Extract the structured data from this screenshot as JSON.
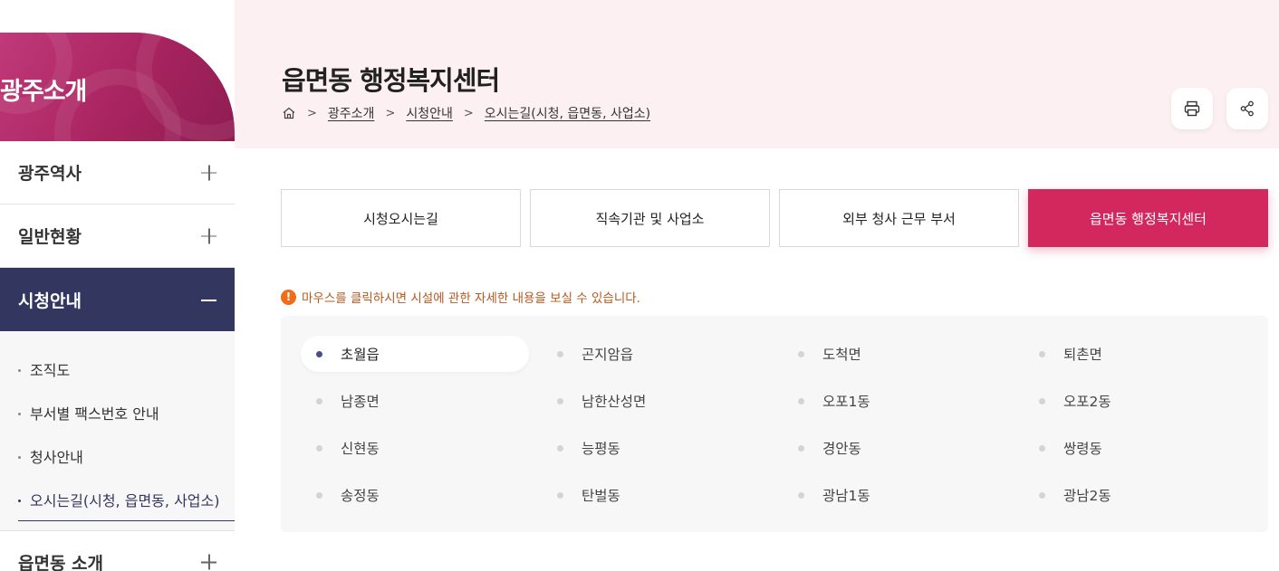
{
  "sidebar": {
    "banner_title": "광주소개",
    "menu": [
      {
        "label": "광주역사"
      },
      {
        "label": "일반현황"
      },
      {
        "label": "시청안내"
      }
    ],
    "submenu": [
      {
        "label": "조직도"
      },
      {
        "label": "부서별 팩스번호 안내"
      },
      {
        "label": "청사안내"
      },
      {
        "label": "오시는길(시청, 읍면동, 사업소)"
      }
    ],
    "last_menu": {
      "label": "읍면동 소개"
    }
  },
  "header": {
    "title": "읍면동 행정복지센터",
    "breadcrumb": [
      "광주소개",
      "시청안내",
      "오시는길(시청, 읍면동, 사업소)"
    ],
    "sep": ">"
  },
  "tabs": [
    {
      "label": "시청오시는길"
    },
    {
      "label": "직속기관 및 사업소"
    },
    {
      "label": "외부 청사 근무 부서"
    },
    {
      "label": "읍면동 행정복지센터"
    }
  ],
  "notice": {
    "icon_glyph": "!",
    "text": "마우스를 클릭하시면 시설에 관한 자세한 내용을 보실 수 있습니다."
  },
  "locations": [
    "초월읍",
    "곤지암읍",
    "도척면",
    "퇴촌면",
    "남종면",
    "남한산성면",
    "오포1동",
    "오포2동",
    "신현동",
    "능평동",
    "경안동",
    "쌍령동",
    "송정동",
    "탄벌동",
    "광남1동",
    "광남2동"
  ],
  "colors": {
    "accent": "#d2285e",
    "sidebar_active": "#33365e",
    "header_bg": "#fdf0f2"
  }
}
